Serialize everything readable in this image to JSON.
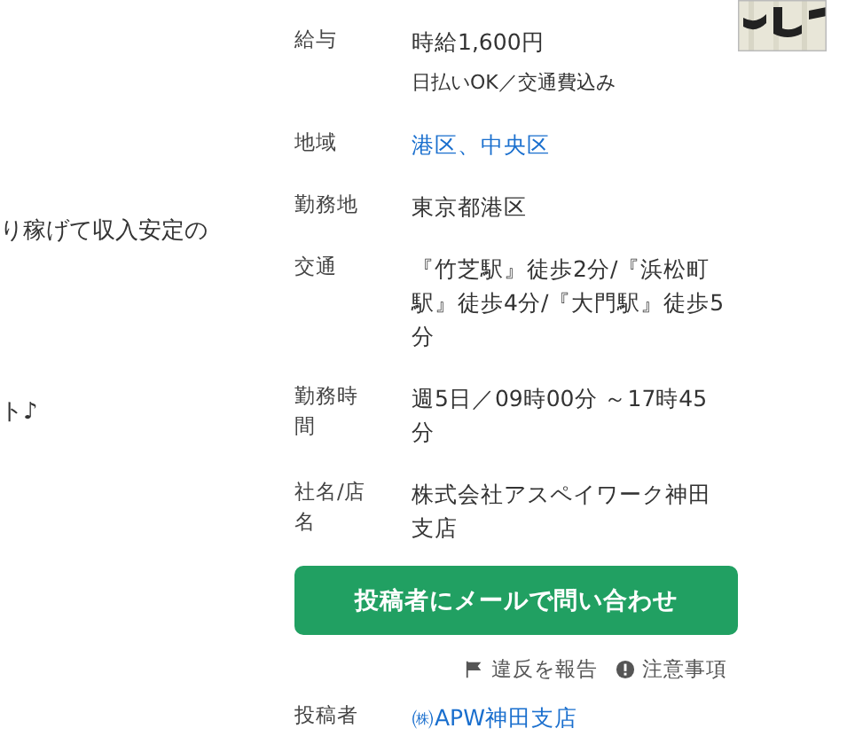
{
  "left_text": [
    {
      "text": "り稼げて収入安定の"
    },
    {
      "text": "ト♪"
    }
  ],
  "details": [
    {
      "label": "給与",
      "value": "時給1,600円",
      "note": "日払いOK／交通費込み",
      "kind": "text"
    },
    {
      "label": "地域",
      "value": "港区、中央区",
      "kind": "link"
    },
    {
      "label": "勤務地",
      "value": "東京都港区",
      "kind": "text"
    },
    {
      "label": "交通",
      "value": "『竹芝駅』徒歩2分/『浜松町駅』徒歩4分/『大門駅』徒歩5分",
      "kind": "text"
    },
    {
      "label": "勤務時間",
      "value": "週5日／09時00分 ～17時45分",
      "kind": "text"
    },
    {
      "label": "社名/店名",
      "value": "株式会社アスペイワーク神田支店",
      "kind": "text"
    }
  ],
  "contact_button": "投稿者にメールで問い合わせ",
  "report_link": "違反を報告",
  "notice_link": "注意事項",
  "poster": {
    "label": "投稿者",
    "value": "㈱APW神田支店"
  }
}
